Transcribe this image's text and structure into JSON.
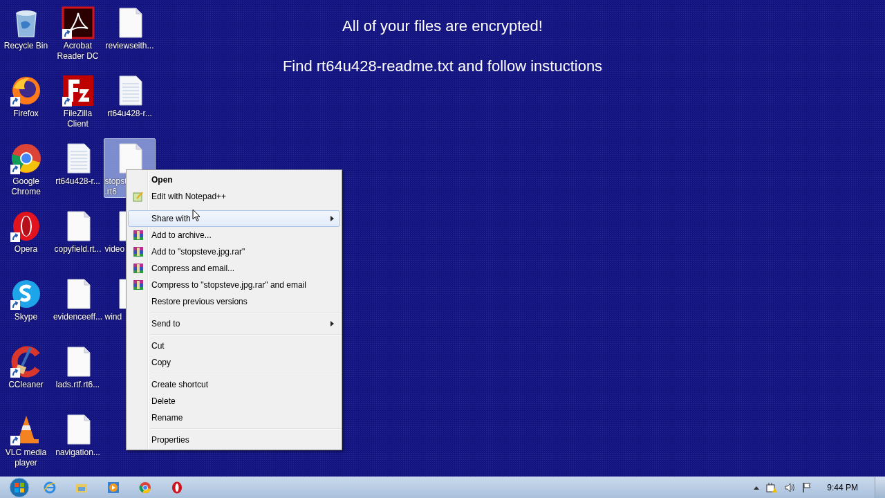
{
  "desktop": {
    "message": [
      "All of your files are encrypted!",
      "Find rt64u428-readme.txt and follow instuctions"
    ],
    "icons": [
      {
        "lines": [
          "Recycle Bin"
        ],
        "kind": "recycle",
        "shortcut": false,
        "selected": false,
        "cut": false
      },
      {
        "lines": [
          "Firefox"
        ],
        "kind": "firefox",
        "shortcut": true,
        "selected": false,
        "cut": false
      },
      {
        "lines": [
          "Google",
          "Chrome"
        ],
        "kind": "chrome",
        "shortcut": true,
        "selected": false,
        "cut": false
      },
      {
        "lines": [
          "Opera"
        ],
        "kind": "opera",
        "shortcut": true,
        "selected": false,
        "cut": false
      },
      {
        "lines": [
          "Skype"
        ],
        "kind": "skype",
        "shortcut": true,
        "selected": false,
        "cut": false
      },
      {
        "lines": [
          "CCleaner"
        ],
        "kind": "ccleaner",
        "shortcut": true,
        "selected": false,
        "cut": false
      },
      {
        "lines": [
          "VLC media",
          "player"
        ],
        "kind": "vlc",
        "shortcut": true,
        "selected": false,
        "cut": false
      },
      {
        "lines": [
          "Acrobat",
          "Reader DC"
        ],
        "kind": "acrobat",
        "shortcut": true,
        "selected": false,
        "cut": false
      },
      {
        "lines": [
          "FileZilla",
          "Client"
        ],
        "kind": "filezilla",
        "shortcut": true,
        "selected": false,
        "cut": false
      },
      {
        "lines": [
          "rt64u428-r..."
        ],
        "kind": "textdoc",
        "shortcut": false,
        "selected": false,
        "cut": false
      },
      {
        "lines": [
          "copyfield.rt..."
        ],
        "kind": "doc",
        "shortcut": false,
        "selected": false,
        "cut": false
      },
      {
        "lines": [
          "evidenceeff..."
        ],
        "kind": "doc",
        "shortcut": false,
        "selected": false,
        "cut": false
      },
      {
        "lines": [
          "lads.rtf.rt6..."
        ],
        "kind": "doc",
        "shortcut": false,
        "selected": false,
        "cut": false
      },
      {
        "lines": [
          "navigation..."
        ],
        "kind": "doc",
        "shortcut": false,
        "selected": false,
        "cut": false
      },
      {
        "lines": [
          "reviewseith..."
        ],
        "kind": "doc",
        "shortcut": false,
        "selected": false,
        "cut": false
      },
      {
        "lines": [
          "rt64u428-r..."
        ],
        "kind": "textdoc",
        "shortcut": false,
        "selected": false,
        "cut": false
      },
      {
        "lines": [
          "stopst",
          ".rt6"
        ],
        "kind": "doc",
        "shortcut": false,
        "selected": true,
        "cut": true
      },
      {
        "lines": [
          "video"
        ],
        "kind": "doc",
        "shortcut": false,
        "selected": false,
        "cut": true
      },
      {
        "lines": [
          "wind"
        ],
        "kind": "doc",
        "shortcut": false,
        "selected": false,
        "cut": true
      }
    ]
  },
  "context_menu": {
    "items": [
      {
        "kind": "plain",
        "label": "Open",
        "bold": true,
        "submenu": false,
        "selected": false
      },
      {
        "kind": "notepad",
        "label": "Edit with Notepad++",
        "bold": false,
        "submenu": false,
        "selected": false
      },
      {
        "kind": "separator"
      },
      {
        "kind": "plain",
        "label": "Share with",
        "bold": false,
        "submenu": true,
        "selected": true
      },
      {
        "kind": "archive",
        "label": "Add to archive...",
        "bold": false,
        "submenu": false,
        "selected": false
      },
      {
        "kind": "archive",
        "label": "Add to \"stopsteve.jpg.rar\"",
        "bold": false,
        "submenu": false,
        "selected": false
      },
      {
        "kind": "archive",
        "label": "Compress and email...",
        "bold": false,
        "submenu": false,
        "selected": false
      },
      {
        "kind": "archive",
        "label": "Compress to \"stopsteve.jpg.rar\" and email",
        "bold": false,
        "submenu": false,
        "selected": false
      },
      {
        "kind": "plain",
        "label": "Restore previous versions",
        "bold": false,
        "submenu": false,
        "selected": false
      },
      {
        "kind": "separator"
      },
      {
        "kind": "plain",
        "label": "Send to",
        "bold": false,
        "submenu": true,
        "selected": false
      },
      {
        "kind": "separator"
      },
      {
        "kind": "plain",
        "label": "Cut",
        "bold": false,
        "submenu": false,
        "selected": false
      },
      {
        "kind": "plain",
        "label": "Copy",
        "bold": false,
        "submenu": false,
        "selected": false
      },
      {
        "kind": "separator"
      },
      {
        "kind": "plain",
        "label": "Create shortcut",
        "bold": false,
        "submenu": false,
        "selected": false
      },
      {
        "kind": "plain",
        "label": "Delete",
        "bold": false,
        "submenu": false,
        "selected": false
      },
      {
        "kind": "plain",
        "label": "Rename",
        "bold": false,
        "submenu": false,
        "selected": false
      },
      {
        "kind": "separator"
      },
      {
        "kind": "plain",
        "label": "Properties",
        "bold": false,
        "submenu": false,
        "selected": false
      }
    ]
  },
  "taskbar": {
    "pinned": [
      {
        "kind": "ie"
      },
      {
        "kind": "explorer"
      },
      {
        "kind": "player"
      },
      {
        "kind": "chrome"
      },
      {
        "kind": "opera"
      }
    ],
    "clock": "9:44 PM"
  }
}
